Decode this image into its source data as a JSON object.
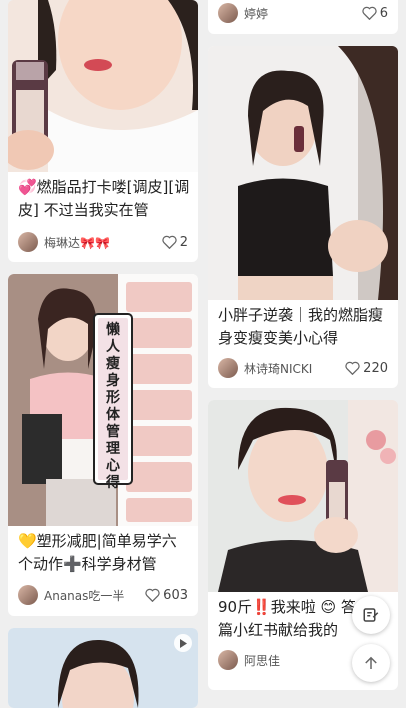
{
  "feed": {
    "cards": [
      {
        "id": "c1",
        "title": "💞燃脂品打卡喽[调皮][调皮] 不过当我实在管",
        "author": "梅琳达🎀🎀",
        "likes": "2"
      },
      {
        "id": "c2",
        "title": "",
        "author": "婷婷",
        "likes": "6"
      },
      {
        "id": "c3",
        "title": "小胖子逆袭｜我的燃脂瘦身变瘦变美小心得",
        "author": "林诗琦NICKI",
        "likes": "220"
      },
      {
        "id": "c4",
        "title": "💛塑形减肥|简单易学六个动作➕科学身材管",
        "author": "Ananas吃一半",
        "likes": "603",
        "overlay": "懒人瘦身 形体管理心得"
      },
      {
        "id": "c5",
        "title": "90斤‼️我来啦 😊 答篇小红书献给我的",
        "author": "阿思佳",
        "likes": ""
      },
      {
        "id": "c6",
        "title": "",
        "author": "",
        "likes": ""
      }
    ]
  },
  "fabs": {
    "edit": "edit-icon",
    "top": "arrow-up-icon"
  }
}
